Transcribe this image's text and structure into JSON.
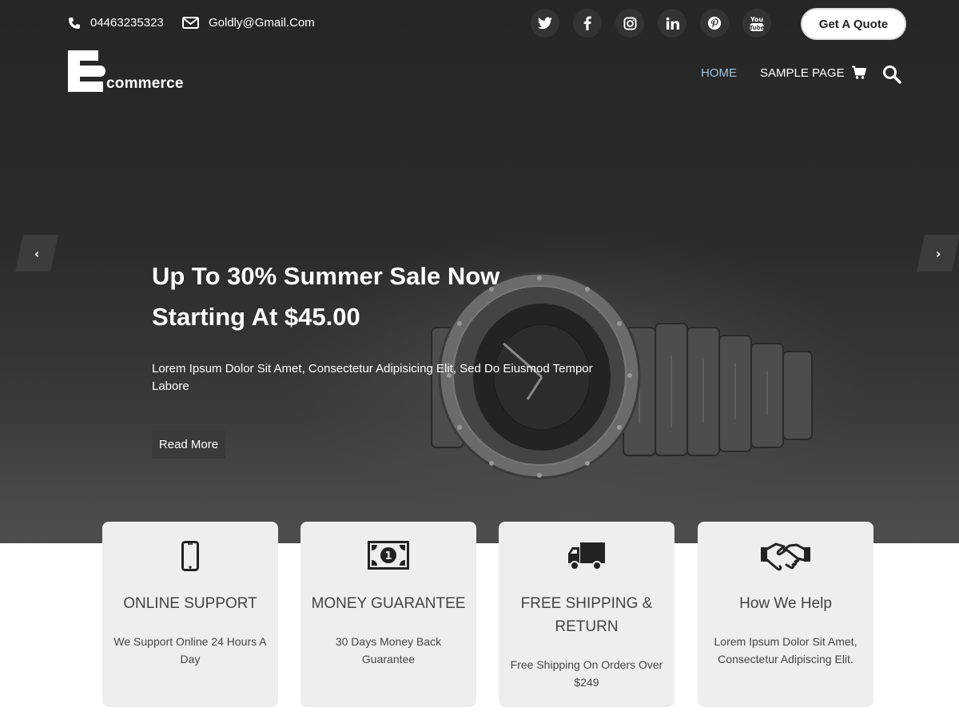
{
  "topbar": {
    "phone": "04463235323",
    "email": "Goldly@Gmail.Com",
    "socials": [
      {
        "icon": "twitter-icon",
        "glyph": "t"
      },
      {
        "icon": "facebook-icon",
        "glyph": "f"
      },
      {
        "icon": "instagram-icon",
        "glyph": ""
      },
      {
        "icon": "linkedin-icon",
        "glyph": "in"
      },
      {
        "icon": "pinterest-icon",
        "glyph": "p"
      },
      {
        "icon": "youtube-icon",
        "glyph": "You"
      }
    ],
    "quote_button": "Get A Quote"
  },
  "header": {
    "logo_letter": "E",
    "logo_text": "commerce",
    "nav": [
      {
        "label": "HOME",
        "active": true
      },
      {
        "label": "SAMPLE PAGE",
        "active": false
      }
    ]
  },
  "hero": {
    "title_line1": "Up To 30% Summer Sale Now",
    "title_line2": "Starting At $45.00",
    "description": "Lorem Ipsum Dolor Sit Amet, Consectetur Adipisicing Elit, Sed Do Eiusmod Tempor Labore",
    "button": "Read More",
    "prev_arrow": "‹",
    "next_arrow": "›"
  },
  "features": [
    {
      "icon": "mobile-phone-icon",
      "title": "ONLINE SUPPORT",
      "text": "We Support Online 24 Hours A Day"
    },
    {
      "icon": "money-bill-icon",
      "title": "MONEY GUARANTEE",
      "text": "30 Days Money Back Guarantee"
    },
    {
      "icon": "truck-icon",
      "title": "FREE SHIPPING & RETURN",
      "text": "Free Shipping On Orders Over $249"
    },
    {
      "icon": "handshake-icon",
      "title": "How We Help",
      "text": "Lorem Ipsum Dolor Sit Amet, Consectetur Adipiscing Elit."
    }
  ],
  "colors": {
    "hero_bg": "#2b2b2b",
    "nav_active": "#9ec3dc",
    "card_bg": "#eeeeee",
    "social_bg": "#333333"
  }
}
